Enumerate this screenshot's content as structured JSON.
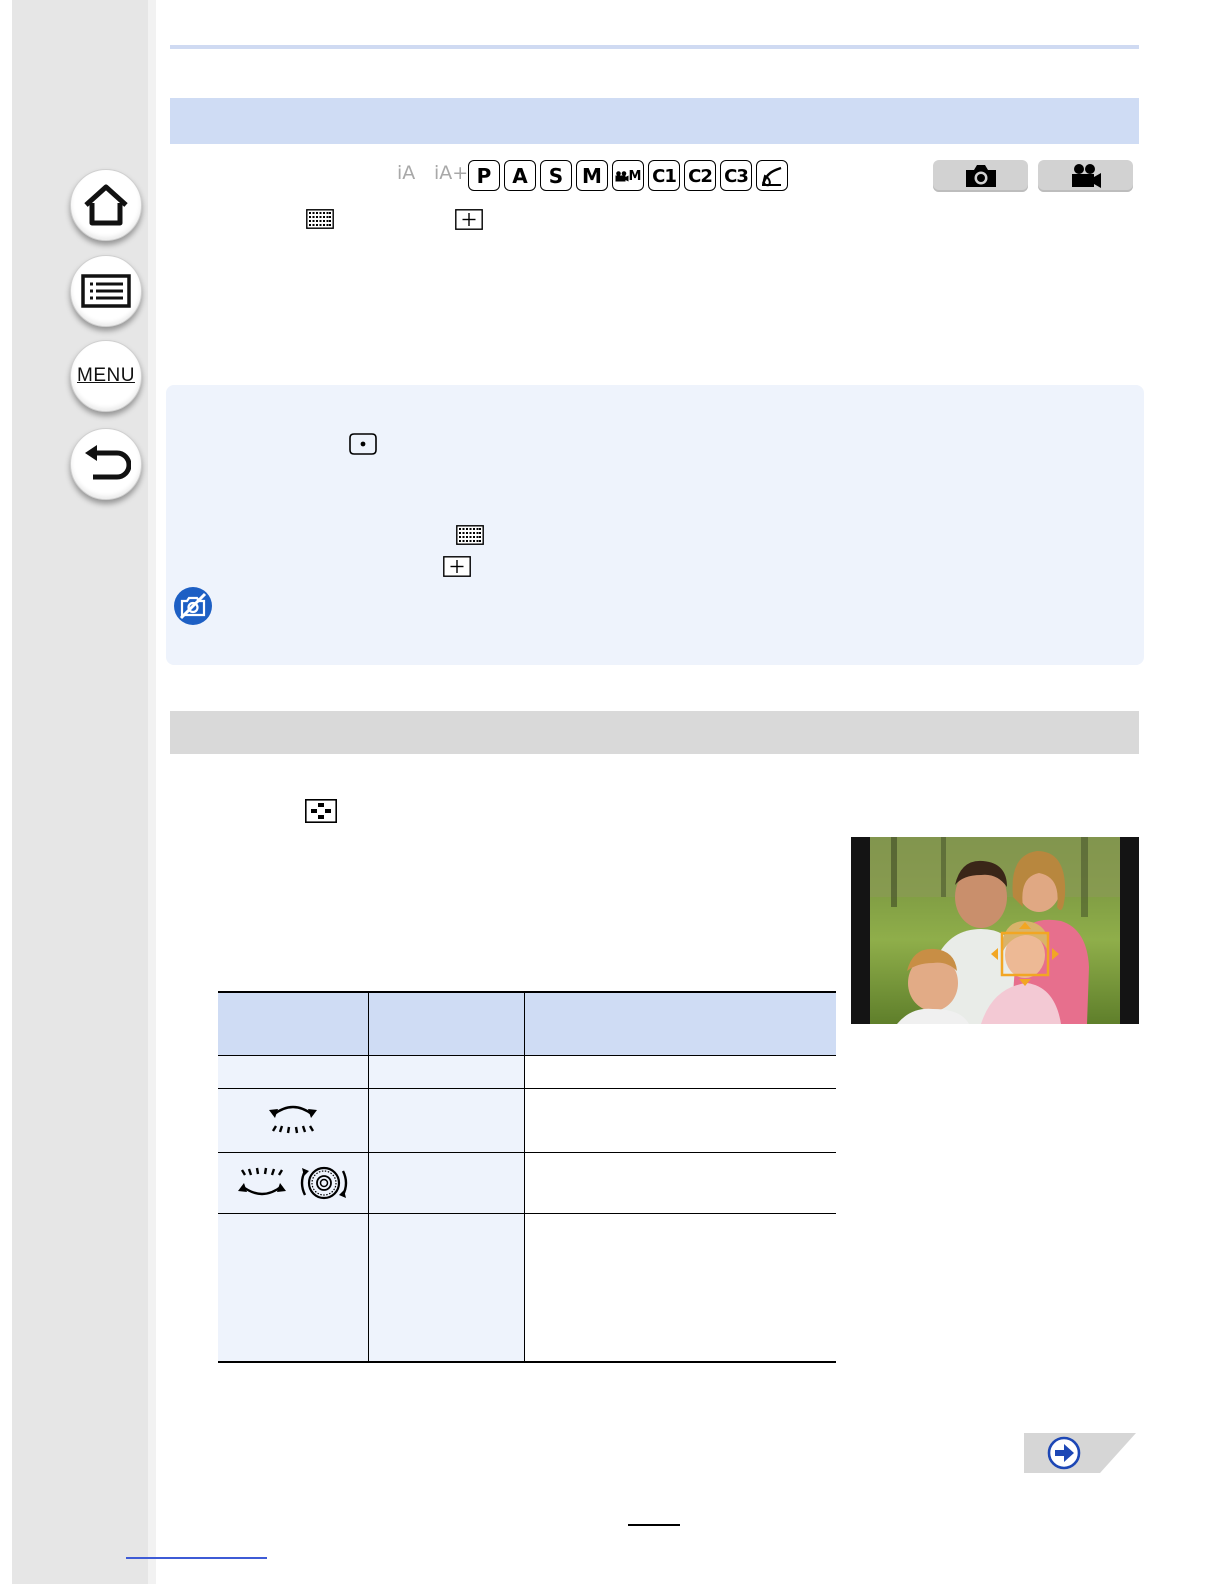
{
  "navigation": {
    "home_icon": "home-icon",
    "contents_icon": "list-icon",
    "menu_label": "MENU",
    "back_icon": "return-icon"
  },
  "mode_row": {
    "dim_modes": [
      "iA",
      "iA+"
    ],
    "modes": [
      "P",
      "A",
      "S",
      "M",
      "C1",
      "C2",
      "C3"
    ],
    "movie_mode": "M",
    "creative_icon": "creative-control-icon",
    "recording_icons": [
      "camera-icon",
      "movie-camera-icon"
    ]
  },
  "colors": {
    "section_bar_blue": "#cfdcf4",
    "section_bar_gray": "#d9d9d9",
    "note_bg": "#eef3fc",
    "not_available_blue": "#1d5fc4",
    "af_frame": "#f2a623"
  },
  "icons": {
    "af_49_area": "49-area-icon",
    "af_pinpoint": "pinpoint-icon",
    "af_1_area": "1-area-icon",
    "af_custom_multi": "custom-multi-icon",
    "not_available": "not-available-icon",
    "front_dial": "front-dial-icon",
    "rear_dial": "rear-dial-icon",
    "control_dial": "control-dial-icon",
    "next_page": "next-page-arrow-icon"
  },
  "photo": {
    "subject": "family-photo-with-af-area"
  }
}
